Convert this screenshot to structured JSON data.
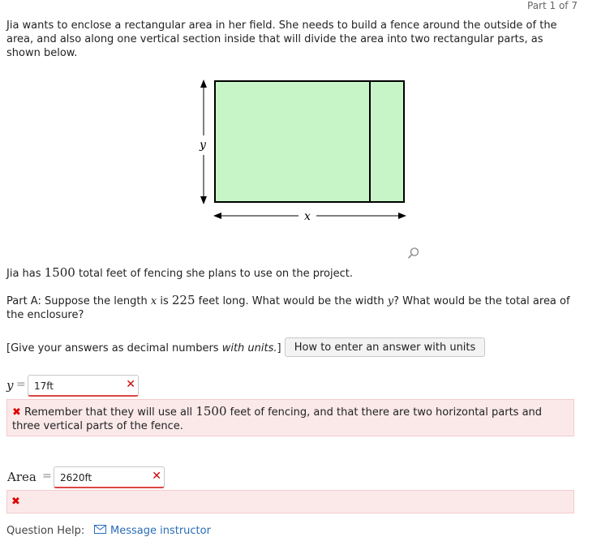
{
  "header": {
    "part_indicator": "Part 1 of 7"
  },
  "problem": {
    "intro": "Jia wants to enclose a rectangular area in her field. She needs to build a fence around the outside of the area, and also along one vertical section inside that will divide the area into two rectangular parts, as shown below.",
    "fencing_sentence_pre": "Jia has ",
    "fencing_total": "1500",
    "fencing_sentence_post": " total feet of fencing she plans to use on the project.",
    "part_a_pre": "Part A: Suppose the length ",
    "part_a_var_x": "x",
    "part_a_mid1": " is ",
    "part_a_length": "225",
    "part_a_mid2": " feet long. What would be the width ",
    "part_a_var_y": "y",
    "part_a_post": "? What would be the total area of the enclosure?",
    "instructions_pre": "[Give your answers as decimal numbers ",
    "instructions_em": "with units.",
    "instructions_post": "]",
    "units_help_button": "How to enter an answer with units"
  },
  "figure": {
    "label_x": "x",
    "label_y": "y",
    "fill_color": "#c7f5c7",
    "zoom_icon": "magnifier-icon"
  },
  "answers": {
    "y": {
      "label": "y",
      "equals": "=",
      "value": "17ft",
      "status_icon": "x-mark-icon",
      "feedback_pre": "Remember that they will use all ",
      "feedback_num": "1500",
      "feedback_post": " feet of fencing, and that there are two horizontal parts and three vertical parts of the fence."
    },
    "area": {
      "label": "Area",
      "equals": "=",
      "value": "2620ft",
      "status_icon": "x-mark-icon"
    }
  },
  "footer": {
    "question_help_label": "Question Help:",
    "message_instructor": "Message instructor",
    "mail_icon": "envelope-icon"
  },
  "colors": {
    "error_red": "#cc0000",
    "feedback_bg": "#fbe9ea",
    "link_blue": "#2a6cb8"
  }
}
